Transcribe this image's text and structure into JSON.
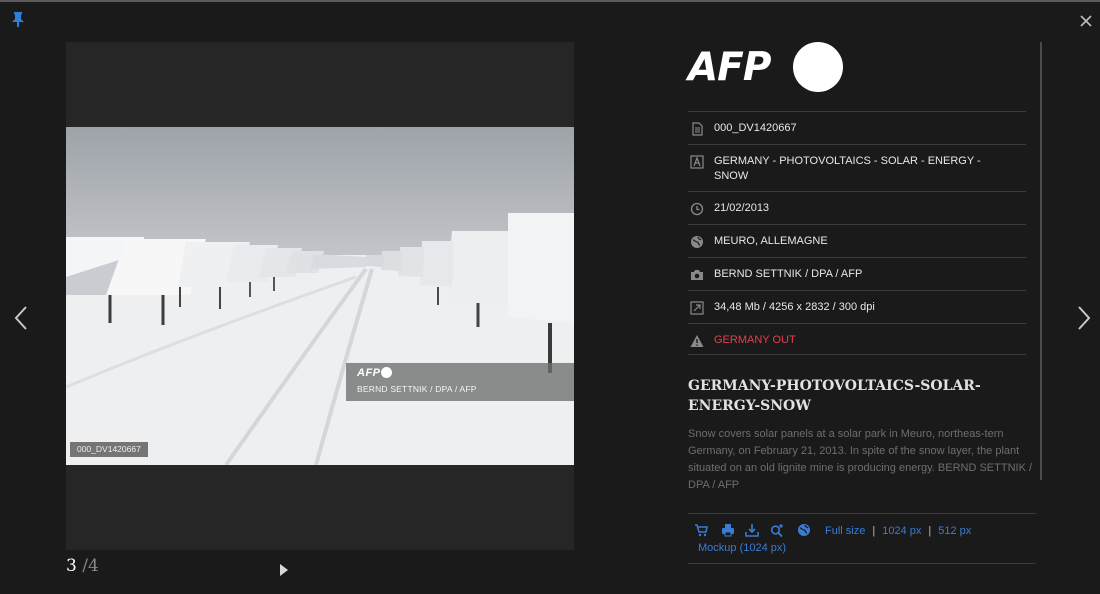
{
  "viewer": {
    "photo_id_label": "000_DV1420667",
    "credit_logo": "AFP",
    "credit_text": "BERND SETTNIK / DPA / AFP",
    "page_current": "3",
    "page_total": "/4"
  },
  "brand": {
    "logo_text": "AFP"
  },
  "meta": {
    "id": "000_DV1420667",
    "title": "GERMANY - PHOTOVOLTAICS - SOLAR - ENERGY - SNOW",
    "date": "21/02/2013",
    "location": "MEURO, ALLEMAGNE",
    "credit": "BERND SETTNIK / DPA / AFP",
    "size": "34,48 Mb / 4256 x 2832 / 300 dpi",
    "restriction": "GERMANY OUT"
  },
  "headline": "GERMANY-PHOTOVOLTAICS-SOLAR-ENERGY-SNOW",
  "caption": "Snow covers solar panels at a solar park in Meuro, northeas-tern Germany, on February 21, 2013. In spite of the snow layer, the plant situated on an old lignite mine is producing energy. BERND SETTNIK / DPA / AFP",
  "actions": {
    "full_size": "Full size",
    "size_1024": "1024 px",
    "size_512": "512 px",
    "mockup": "Mockup (1024 px)",
    "separator": "|"
  },
  "icons": [
    "pin-icon",
    "close-icon",
    "chevron-left-icon",
    "chevron-right-icon",
    "play-icon",
    "document-icon",
    "letter-a-icon",
    "clock-icon",
    "globe-icon",
    "camera-icon",
    "resize-icon",
    "warning-icon",
    "cart-icon",
    "print-icon",
    "download-icon",
    "zoom-plus-icon",
    "globe-icon"
  ],
  "colors": {
    "background": "#1a1a1a",
    "link": "#3a7bd5",
    "warning": "#e0404f"
  }
}
